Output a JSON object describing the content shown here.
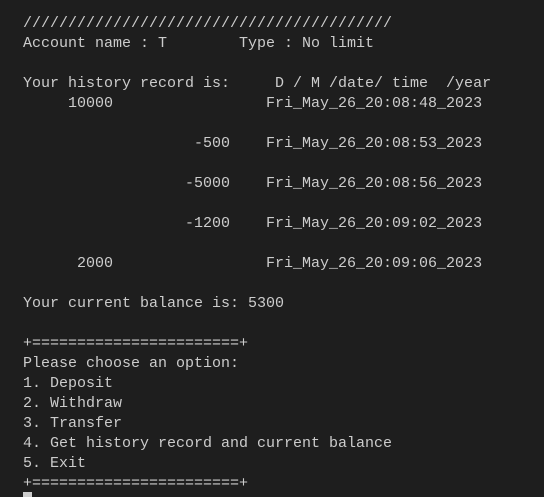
{
  "separator_top": "/////////////////////////////////////////",
  "account": {
    "name_label": "Account name : T",
    "type_label": "Type : No limit"
  },
  "history": {
    "heading": "Your history record is:",
    "column_header": "D / M /date/ time  /year",
    "records": [
      {
        "amount": "10000",
        "timestamp": "Fri_May_26_20:08:48_2023"
      },
      {
        "amount": "-500",
        "timestamp": "Fri_May_26_20:08:53_2023"
      },
      {
        "amount": "-5000",
        "timestamp": "Fri_May_26_20:08:56_2023"
      },
      {
        "amount": "-1200",
        "timestamp": "Fri_May_26_20:09:02_2023"
      },
      {
        "amount": "2000",
        "timestamp": "Fri_May_26_20:09:06_2023"
      }
    ]
  },
  "balance_line": "Your current balance is: 5300",
  "menu": {
    "border": "+=======================+",
    "prompt": "Please choose an option:",
    "options": [
      "1. Deposit",
      "2. Withdraw",
      "3. Transfer",
      "4. Get history record and current balance",
      "5. Exit"
    ]
  }
}
